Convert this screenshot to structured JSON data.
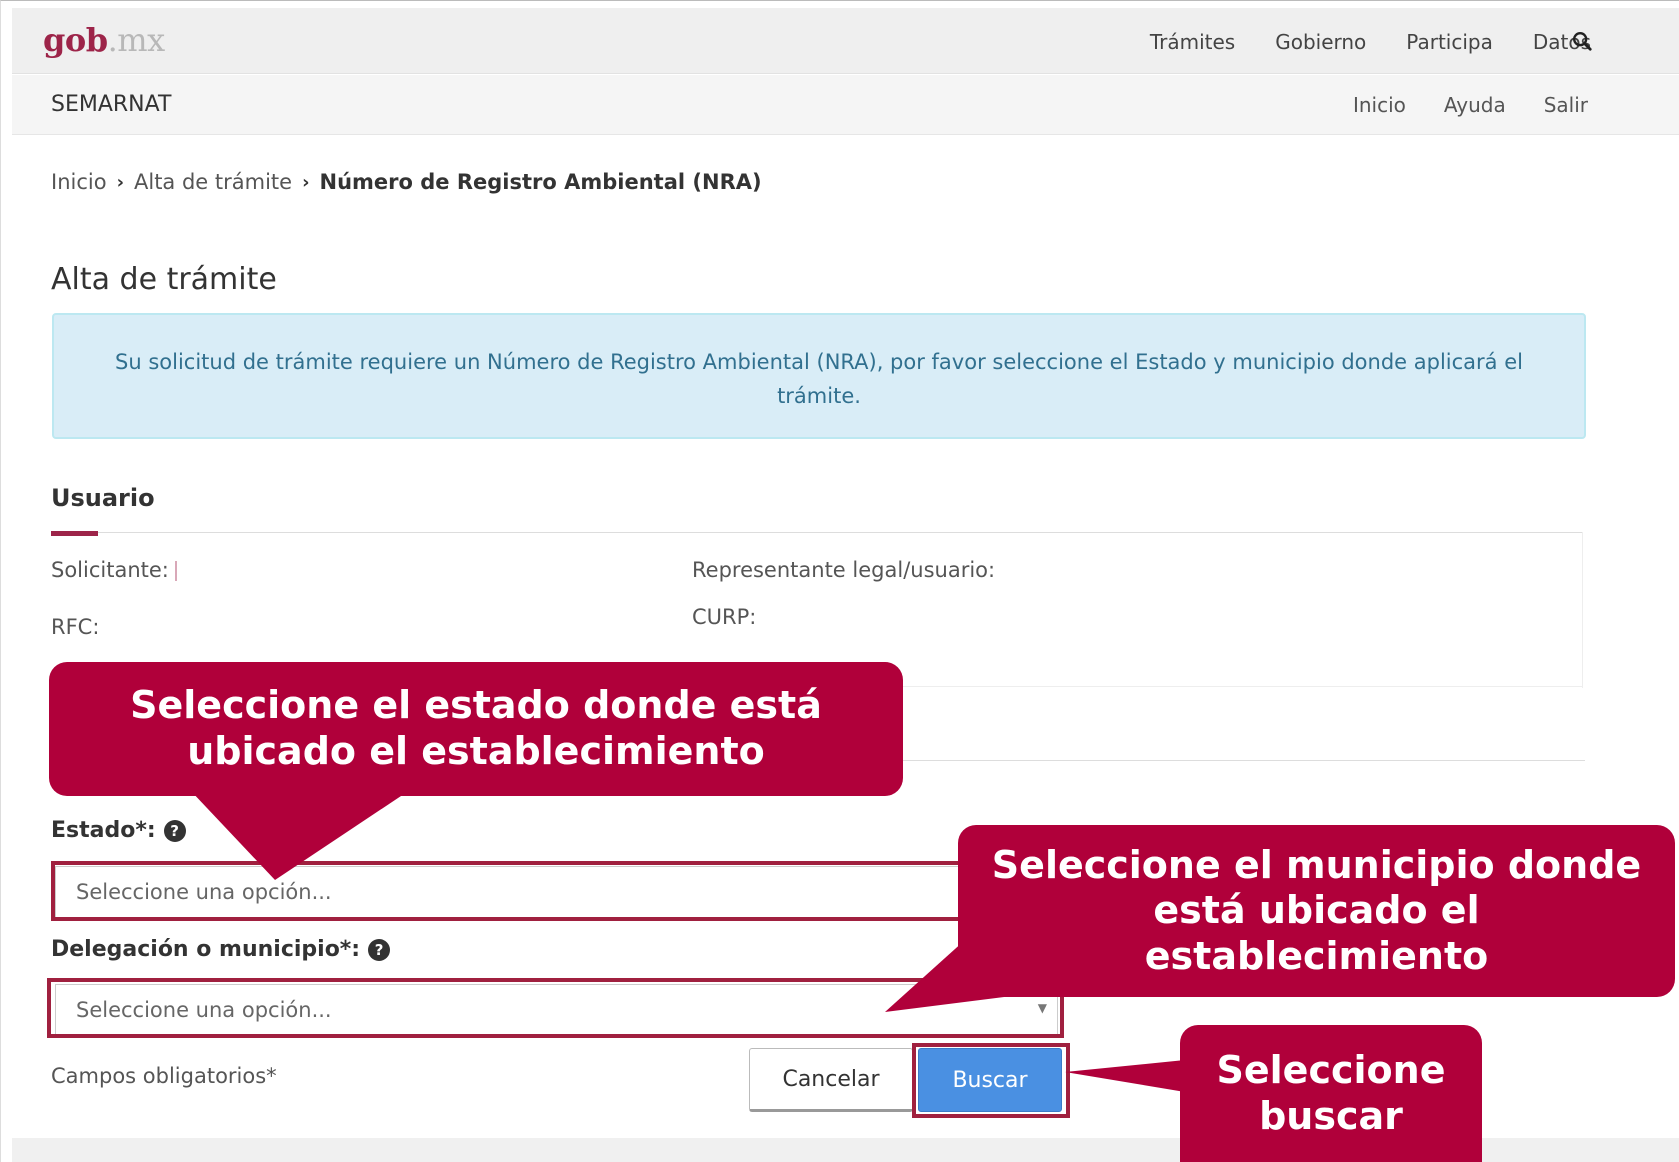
{
  "header": {
    "logo_brand": "gob",
    "logo_domain": ".mx",
    "nav": [
      "Trámites",
      "Gobierno",
      "Participa",
      "Datos"
    ]
  },
  "subheader": {
    "brand": "SEMARNAT",
    "nav": [
      "Inicio",
      "Ayuda",
      "Salir"
    ]
  },
  "breadcrumb": {
    "items": [
      "Inicio",
      "Alta de trámite"
    ],
    "current": "Número de Registro Ambiental (NRA)"
  },
  "page": {
    "title": "Alta de trámite",
    "alert": "Su solicitud de trámite requiere un Número de Registro Ambiental (NRA), por favor seleccione el Estado y municipio donde aplicará el trámite."
  },
  "user_section": {
    "title": "Usuario",
    "solicitante_label": "Solicitante:",
    "representante_label": "Representante legal/usuario:",
    "rfc_label": "RFC:",
    "curp_label": "CURP:"
  },
  "form": {
    "estado_label": "Estado*:",
    "estado_placeholder": "Seleccione una opción...",
    "municipio_label": "Delegación o municipio*:",
    "municipio_placeholder": "Seleccione una opción...",
    "required_note": "Campos obligatorios*",
    "cancel_label": "Cancelar",
    "search_label": "Buscar"
  },
  "callouts": {
    "estado": "Seleccione el estado donde está ubicado el establecimiento",
    "municipio": "Seleccione el municipio donde está ubicado el establecimiento",
    "buscar": "Seleccione buscar"
  },
  "colors": {
    "accent": "#9d2449",
    "callout": "#b0003a",
    "alert_bg": "#d9edf7",
    "alert_text": "#31708f",
    "primary_button": "#4a90e2"
  }
}
